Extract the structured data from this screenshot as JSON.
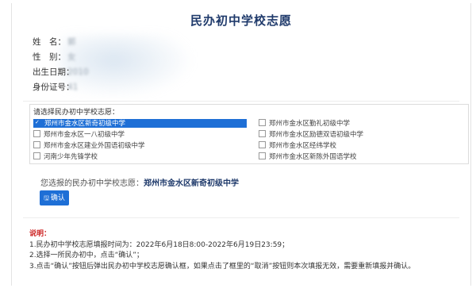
{
  "page": {
    "title": "民办初中学校志愿"
  },
  "info": {
    "name_label": "姓　名：",
    "name_value": "郭",
    "gender_label": "性　别：",
    "gender_value": "女",
    "birth_label": "出生日期：",
    "birth_value": "2010",
    "id_label": "身份证号：",
    "id_value": "41"
  },
  "choices": {
    "title": "请选择民办初中学校志愿：",
    "options": [
      {
        "label": "郑州市金水区新奇初级中学",
        "checked": true
      },
      {
        "label": "郑州市金水区勤礼初级中学",
        "checked": false
      },
      {
        "label": "郑州市金水区一八初级中学",
        "checked": false
      },
      {
        "label": "郑州市金水区励德双语初级中学",
        "checked": false
      },
      {
        "label": "郑州市金水区建业外国语初级中学",
        "checked": false
      },
      {
        "label": "郑州市金水区经纬学校",
        "checked": false
      },
      {
        "label": "河南少年先锋学校",
        "checked": false
      },
      {
        "label": "郑州市金水区新陈外国语学校",
        "checked": false
      }
    ]
  },
  "selected": {
    "prefix": "您选报的民办初中学校志愿：",
    "value": "郑州市金水区新奇初级中学"
  },
  "confirm": {
    "icon": "save-icon",
    "label": "确认"
  },
  "notes": {
    "title": "说明：",
    "lines": [
      "1.民办初中学校志愿填报时间为：2022年6月18日8:00-2022年6月19日23:59；",
      "2.选择一所民办初中，点击“确认”；",
      "3.点击“确认”按钮后弹出民办初中学校志愿确认框，如果点击了框里的“取消”按钮则本次填报无效，需要重新填报并确认。"
    ]
  },
  "colors": {
    "accent": "#1e6fd6",
    "title": "#1f3a6b",
    "warning": "#cc2222"
  }
}
